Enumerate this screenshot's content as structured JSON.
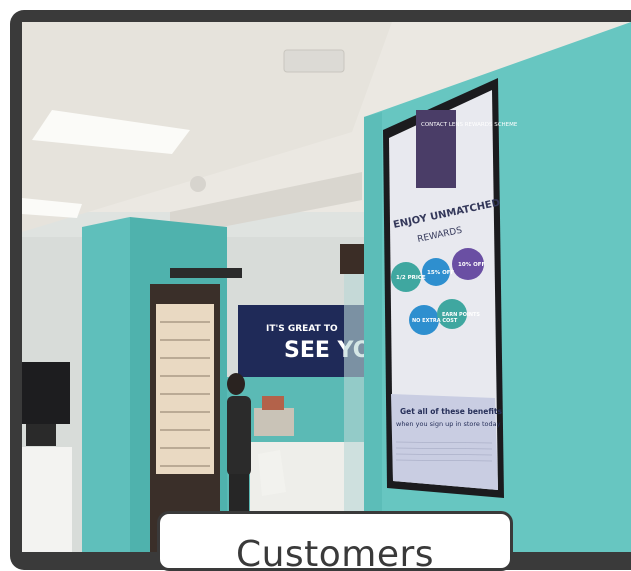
{
  "caption": {
    "label": "Customers"
  },
  "photo": {
    "wall_sign": "IT'S GREAT TO SEE YO",
    "wall_sign_line1": "IT'S GREAT TO",
    "wall_sign_line2": "SEE YO",
    "screen": {
      "header": "CONTACT LENS REWARDS SCHEME",
      "headline_line1": "ENJOY UNMATCHED",
      "headline_line2": "REWARDS",
      "badges": [
        {
          "text": "1/2 PRICE",
          "color": "#3fa7a0"
        },
        {
          "text": "15% OFF",
          "color": "#2e8fcf"
        },
        {
          "text": "10% OFF",
          "color": "#6a4fa3"
        },
        {
          "text": "NO EXTRA COST",
          "color": "#2e8fcf"
        },
        {
          "text": "EARN POINTS",
          "color": "#3fa7a0"
        }
      ],
      "footer_line1": "Get all of these benefits",
      "footer_line2": "when you sign up in store today"
    },
    "colors": {
      "teal_wall": "#67c6c1",
      "ceiling": "#ece9e4",
      "screen_bezel": "#1b1b1e",
      "navy_sign": "#1f2a58",
      "card_border": "#3a3a3a"
    }
  }
}
